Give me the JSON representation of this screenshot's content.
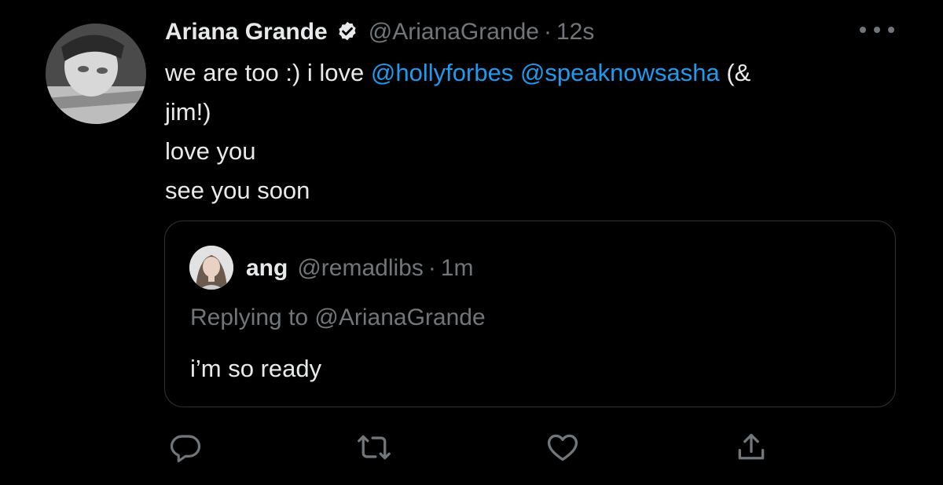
{
  "tweet": {
    "author_name": "Ariana Grande",
    "handle": "@ArianaGrande",
    "separator": "·",
    "time": "12s",
    "verified": true,
    "text": {
      "line1_pre": "we are too :) i love",
      "mention1": "@hollyforbes",
      "mention2": "@speaknowsasha",
      "line1_post": "(&",
      "line2": "jim!)",
      "line3": "love you",
      "line4": "see you soon"
    }
  },
  "quoted_tweet": {
    "author_name": "ang",
    "handle": "@remadlibs",
    "separator": "·",
    "time": "1m",
    "replying_to": "Replying to @ArianaGrande",
    "text": "i’m so ready"
  },
  "actions": [
    {
      "icon": "reply-icon"
    },
    {
      "icon": "retweet-icon"
    },
    {
      "icon": "like-icon"
    },
    {
      "icon": "share-icon"
    }
  ],
  "colors": {
    "background": "#000000",
    "text": "#e7e9ea",
    "muted": "#71767b",
    "link": "#1d9bf0",
    "border": "#2f3336"
  }
}
